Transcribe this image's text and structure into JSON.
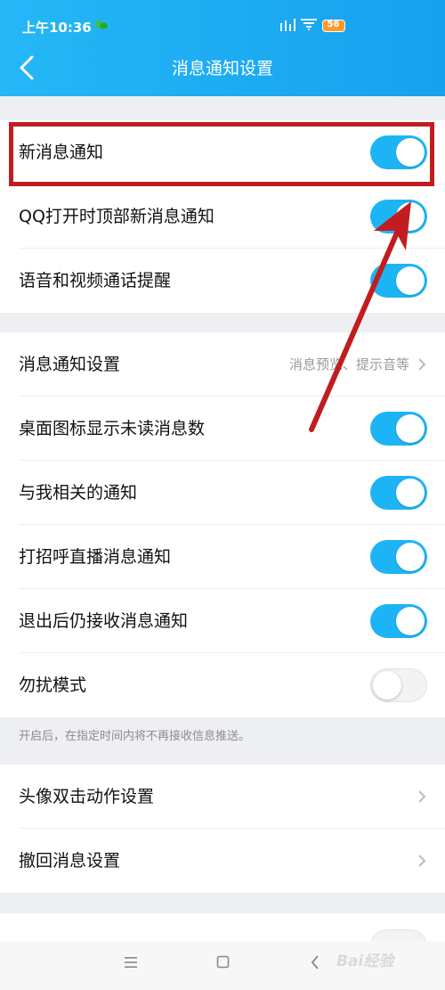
{
  "status_bar": {
    "time": "上午10:36",
    "battery": "56"
  },
  "header": {
    "title": "消息通知设置"
  },
  "group1": {
    "items": [
      {
        "label": "新消息通知",
        "toggle": "on"
      },
      {
        "label": "QQ打开时顶部新消息通知",
        "toggle": "on"
      },
      {
        "label": "语音和视频通话提醒",
        "toggle": "on"
      }
    ]
  },
  "group2": {
    "notify_settings": {
      "label": "消息通知设置",
      "value": "消息预览、提示音等"
    },
    "items": [
      {
        "label": "桌面图标显示未读消息数",
        "toggle": "on"
      },
      {
        "label": "与我相关的通知",
        "toggle": "on"
      },
      {
        "label": "打招呼直播消息通知",
        "toggle": "on"
      },
      {
        "label": "退出后仍接收消息通知",
        "toggle": "on"
      },
      {
        "label": "勿扰模式",
        "toggle": "off"
      }
    ],
    "note": "开启后，在指定时间内将不再接收信息推送。"
  },
  "group3": {
    "items": [
      {
        "label": "头像双击动作设置"
      },
      {
        "label": "撤回消息设置"
      }
    ]
  },
  "watermark": "Bai经验",
  "colors": {
    "accent": "#1db4f5",
    "header": "#1ea8f1",
    "annotation": "#c11d21"
  }
}
